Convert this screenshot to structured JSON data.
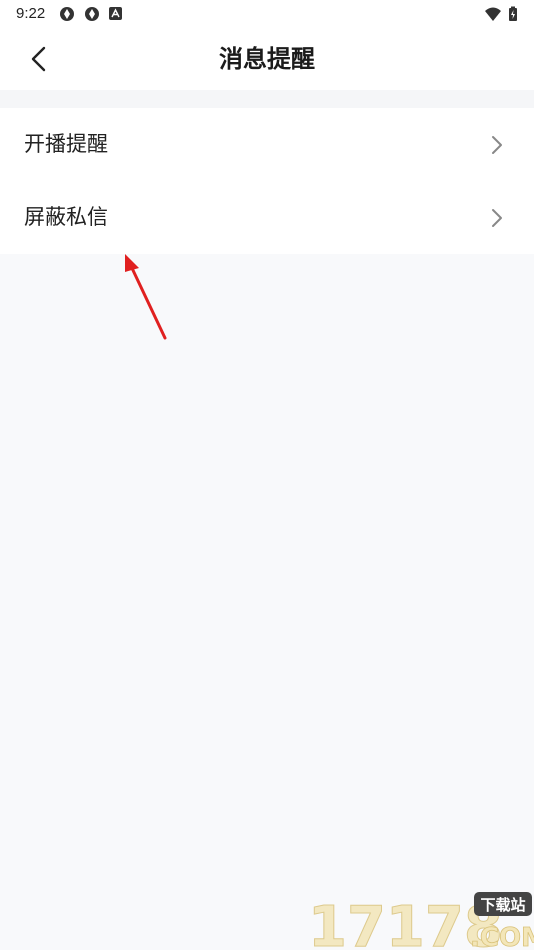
{
  "status_bar": {
    "time": "9:22",
    "left_icons": [
      "aperture-icon",
      "aperture-icon",
      "a-badge-icon"
    ],
    "right_icons": [
      "wifi-icon",
      "battery-charging-icon"
    ]
  },
  "header": {
    "title": "消息提醒",
    "back_icon": "chevron-left-icon"
  },
  "menu": {
    "items": [
      {
        "label": "开播提醒",
        "icon": "chevron-right-icon"
      },
      {
        "label": "屏蔽私信",
        "icon": "chevron-right-icon"
      }
    ]
  },
  "annotation": {
    "arrow_color": "#e02020"
  },
  "watermark": {
    "brand_number": "17178",
    "badge_text": "下载站",
    "domain": ".COM"
  },
  "colors": {
    "page_background": "#f8f9fb",
    "card_background": "#ffffff",
    "text_primary": "#222222",
    "chevron": "#888888"
  }
}
